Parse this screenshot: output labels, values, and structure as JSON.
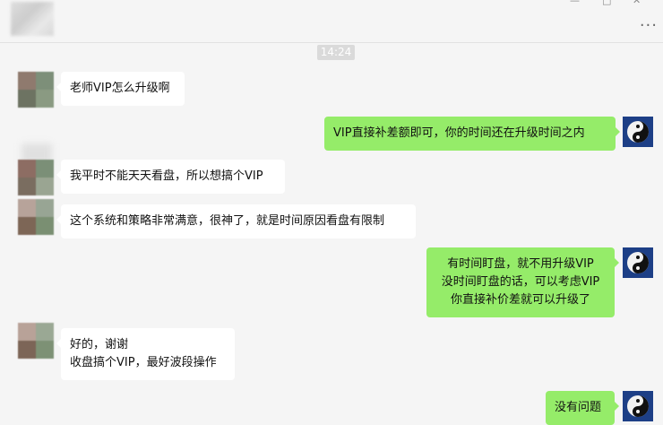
{
  "header": {
    "minimize_glyph": "—",
    "restore_glyph": "□",
    "close_glyph": "✕",
    "more_glyph": "···"
  },
  "timestamp": "14:24",
  "colors": {
    "incoming_bubble": "#ffffff",
    "outgoing_bubble": "#95ec69",
    "background": "#f5f5f5"
  },
  "messages": [
    {
      "side": "in",
      "text": "老师VIP怎么升级啊"
    },
    {
      "side": "out",
      "text": "VIP直接补差额即可，你的时间还在升级时间之内"
    },
    {
      "side": "in",
      "text": "我平时不能天天看盘，所以想搞个VIP"
    },
    {
      "side": "in",
      "text": "这个系统和策略非常满意，很神了，就是时间原因看盘有限制"
    },
    {
      "side": "out",
      "text": "有时间盯盘，就不用升级VIP\n没时间盯盘的话，可以考虑VIP\n你直接补价差就可以升级了"
    },
    {
      "side": "in",
      "text": "好的，谢谢\n收盘搞个VIP，最好波段操作"
    },
    {
      "side": "out",
      "text": "没有问题"
    }
  ]
}
